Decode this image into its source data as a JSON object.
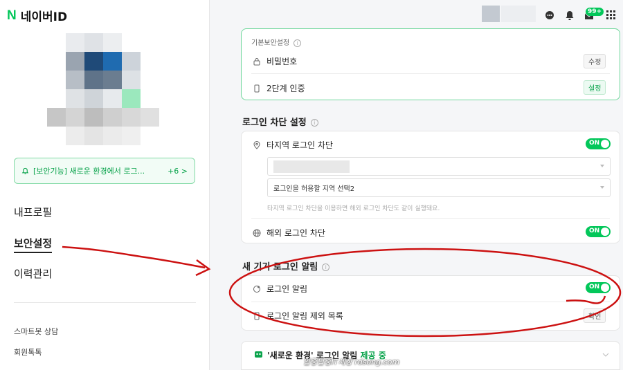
{
  "sidebar": {
    "logo_mark": "N",
    "logo_text": "네이버ID",
    "alert_text": "[보안기능] 새로운 환경에서 로그...",
    "alert_count": "+6 >",
    "menu": [
      "내프로필",
      "보안설정",
      "이력관리"
    ],
    "active_menu": "보안설정",
    "sub_links": [
      "스마트봇 상담",
      "회원톡톡"
    ]
  },
  "header": {
    "notification_badge": "99+",
    "icons": [
      "chat-icon",
      "bell-icon",
      "mail-icon",
      "apps-grid-icon"
    ]
  },
  "basic_security": {
    "title": "기본보안설정",
    "password_label": "비밀번호",
    "password_button": "수정",
    "two_factor_label": "2단계 인증",
    "two_factor_button": "설정"
  },
  "login_block": {
    "title": "로그인 차단 설정",
    "region_block_label": "타지역 로그인 차단",
    "region_select_2": "로그인을 허용할 지역 선택2",
    "region_hint": "타지역 로그인 차단을 이용하면 해외 로그인 차단도 같이 실행돼요.",
    "overseas_block_label": "해외 로그인 차단",
    "toggle_on_text": "ON"
  },
  "new_device": {
    "title": "새 기기 로그인 알림",
    "login_alert_label": "로그인 알림",
    "exclude_list_label": "로그인 알림 제외 목록",
    "exclude_button": "확인"
  },
  "promo": {
    "text_main": "'새로운 환경' 로그인 알림",
    "text_status": "제공 중"
  },
  "watermark": "알중달중IT세상 rdsong.com",
  "colors": {
    "accent": "#03c75a",
    "annotation": "#cc1111"
  }
}
